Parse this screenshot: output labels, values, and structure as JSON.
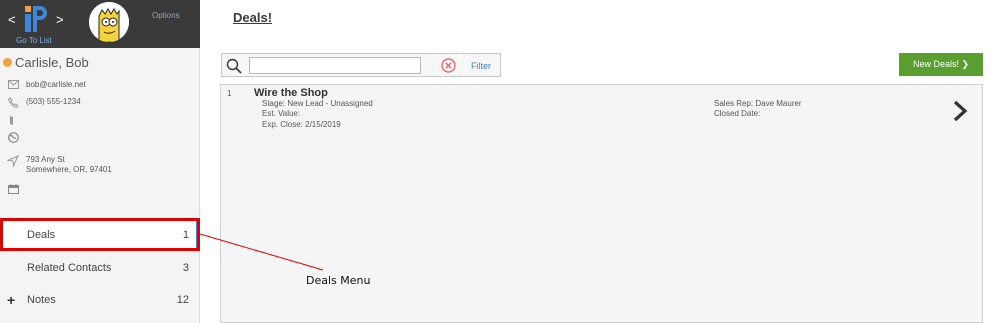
{
  "nav": {
    "back_glyph": "<",
    "forward_glyph": ">",
    "go_to_list": "Go To List",
    "options": "Options"
  },
  "contact": {
    "name": "Carlisle, Bob",
    "email": "bob@carlisle.net",
    "phone": "(503) 555-1234",
    "address_line1": "793 Any St",
    "address_line2": "Somewhere, OR, 97401",
    "status_color": "#f2a23a"
  },
  "menu": {
    "items": [
      {
        "label": "Deals",
        "count": "1",
        "active": true
      },
      {
        "label": "Related Contacts",
        "count": "3",
        "active": false
      },
      {
        "label": "Notes",
        "count": "12",
        "active": false,
        "prefix": "+"
      }
    ]
  },
  "page": {
    "title": "Deals!"
  },
  "search": {
    "value": "",
    "placeholder": "",
    "filter_label": "Filter"
  },
  "new_deal_button": {
    "label": "New Deals! ❯"
  },
  "deals": [
    {
      "number": "1",
      "title": "Wire the Shop",
      "stage": "Stage:  New Lead - Unassigned",
      "est_value": "Est. Value:",
      "exp_close": "Exp. Close: 2/15/2019",
      "sales_rep": "Sales Rep: Dave  Maurer",
      "closed_date": "Closed Date:"
    }
  ],
  "annotation": {
    "label": "Deals Menu",
    "color": "#e00000"
  },
  "colors": {
    "accent_blue": "#3d88d8",
    "button_green": "#5a9e2f",
    "topbar": "#3a3a3a"
  }
}
